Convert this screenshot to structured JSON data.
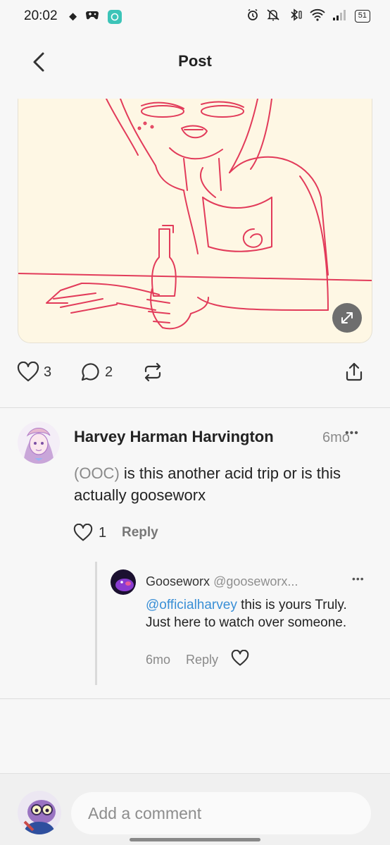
{
  "status_bar": {
    "time": "20:02",
    "battery": "51",
    "left_icons": [
      "weather-icon",
      "gamepad-icon",
      "chat-app-icon"
    ],
    "right_icons": [
      "alarm-icon",
      "mute-icon",
      "bluetooth-icon",
      "wifi-icon",
      "signal-icon",
      "battery-icon"
    ]
  },
  "header": {
    "title": "Post"
  },
  "post": {
    "likes": "3",
    "comments": "2"
  },
  "comment": {
    "author": "Harvey Harman Harvington",
    "time": "6mo",
    "body_prefix": "(OOC)",
    "body_rest": " is this another acid trip or is this actually gooseworx",
    "likes": "1",
    "reply_label": "Reply",
    "reply": {
      "author": "Gooseworx",
      "handle": "@gooseworx...",
      "mention": "@officialharvey",
      "body_rest": " this is yours Truly. Just here to watch over someone.",
      "time": "6mo",
      "reply_label": "Reply"
    }
  },
  "composer": {
    "placeholder": "Add a comment"
  },
  "colors": {
    "mention": "#3a8fd6",
    "drawing_line": "#e23b5a",
    "image_background": "#fef7e4"
  }
}
